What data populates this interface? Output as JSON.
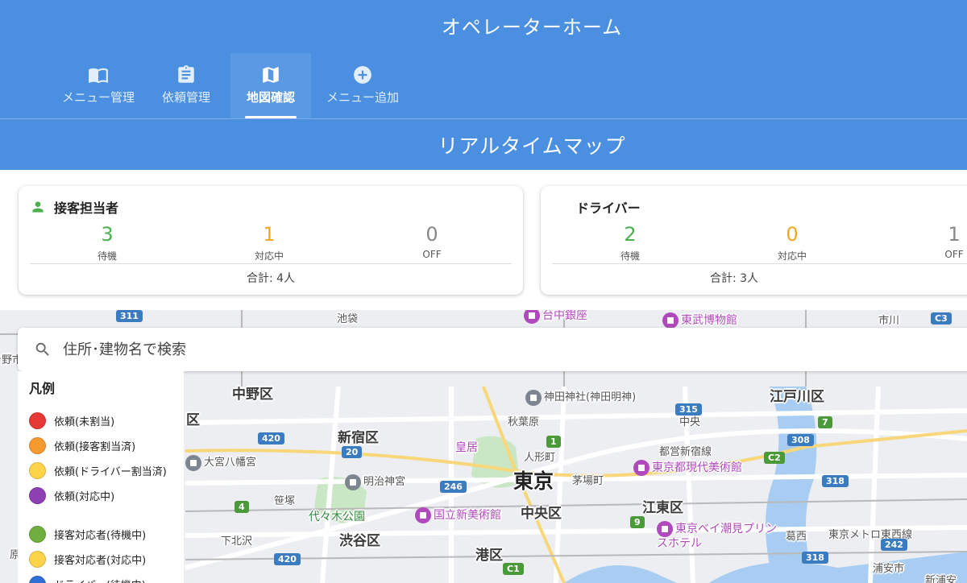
{
  "header": {
    "title": "オペレーターホーム",
    "tabs": [
      {
        "label": "メニュー管理",
        "icon": "book-open-icon",
        "active": false
      },
      {
        "label": "依頼管理",
        "icon": "clipboard-icon",
        "active": false
      },
      {
        "label": "地図確認",
        "icon": "map-icon",
        "active": true
      },
      {
        "label": "メニュー追加",
        "icon": "plus-circle-icon",
        "active": false
      }
    ]
  },
  "subheader": {
    "title": "リアルタイムマップ"
  },
  "staff_card": {
    "title": "接客担当者",
    "stats": [
      {
        "value": "3",
        "label": "待機",
        "color": "#4caf50"
      },
      {
        "value": "1",
        "label": "対応中",
        "color": "#f5a623"
      },
      {
        "value": "0",
        "label": "OFF",
        "color": "#888888"
      }
    ],
    "total": "合計: 4人"
  },
  "driver_card": {
    "title": "ドライバー",
    "stats": [
      {
        "value": "2",
        "label": "待機",
        "color": "#4caf50"
      },
      {
        "value": "0",
        "label": "対応中",
        "color": "#f5a623"
      },
      {
        "value": "1",
        "label": "OFF",
        "color": "#888888"
      }
    ],
    "total": "合計: 3人"
  },
  "map": {
    "search": {
      "placeholder": "住所･建物名で検索"
    },
    "legend": {
      "title": "凡例",
      "items": [
        {
          "label": "依頼(未割当)",
          "color": "#e53935"
        },
        {
          "label": "依頼(接客割当済)",
          "color": "#f59a2e"
        },
        {
          "label": "依頼(ドライバー割当済)",
          "color": "#fdd34a"
        },
        {
          "label": "依頼(対応中)",
          "color": "#8e3fb3"
        },
        {
          "label": "接客対応者(待機中)",
          "color": "#6fae3f"
        },
        {
          "label": "接客対応者(対応中)",
          "color": "#fdd34a"
        },
        {
          "label": "ドライバー(待機中)",
          "color": "#2f6fd6"
        }
      ]
    },
    "labels": {
      "nakano": "中野区",
      "shinjuku": "新宿区",
      "chiyoda_partial": "区",
      "edogawa": "江戸川区",
      "tokyo": "東京",
      "chuo": "中央区",
      "koto": "江東区",
      "shibuya": "渋谷区",
      "minato": "港区",
      "urayasu": "浦安市",
      "ichikawa": "市川",
      "ikebukuro": "池袋",
      "akihabara": "秋葉原",
      "ningyocho": "人形町",
      "kayabacho": "茅場町",
      "sasazuka": "笹塚",
      "shimokitazawa": "下北沢",
      "kasai": "葛西",
      "kotobashi": "東京メトロ東西線",
      "sumiyoshi": "都営新宿線",
      "shinurayasu": "新浦安",
      "kokyo": "皇居",
      "meijijingu": "明治神宮",
      "yoyogi": "代々木公園",
      "omiya": "大宮八幡宮",
      "kanda": "神田神社(神田明神)",
      "tobu": "東武博物館",
      "taitoginza": "台中銀座",
      "gendai": "東京都現代美術館",
      "kokuritsu": "国立新美術館",
      "bayside": "東京ベイ潮見プリンスホテル",
      "hara": "原",
      "nomura": "野市",
      "chuo_line": "中央",
      "shinjuku_line": "新宿線"
    }
  }
}
